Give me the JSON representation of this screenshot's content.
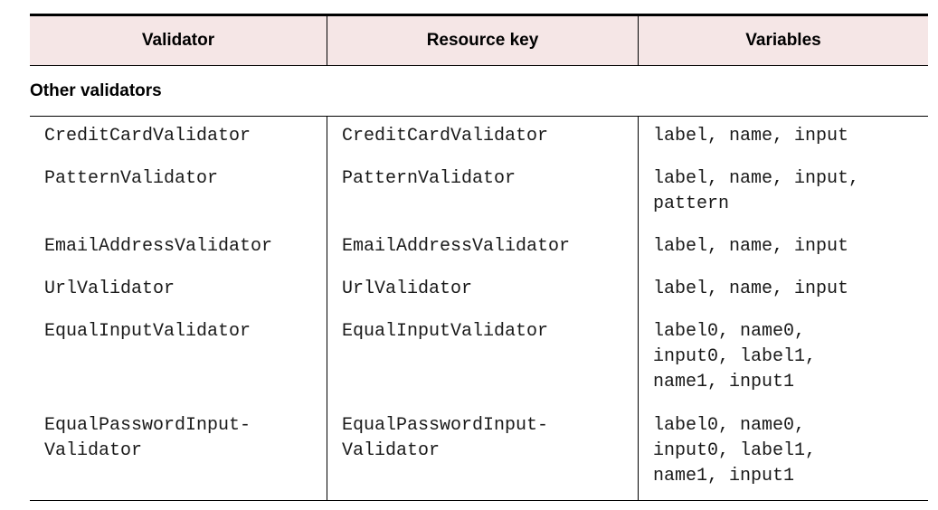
{
  "table": {
    "headers": [
      "Validator",
      "Resource key",
      "Variables"
    ],
    "section_title": "Other validators",
    "rows": [
      {
        "validator": "CreditCardValidator",
        "resource_key": "CreditCardValidator",
        "variables": "label, name, input"
      },
      {
        "validator": "PatternValidator",
        "resource_key": "PatternValidator",
        "variables": "label, name, input,\npattern"
      },
      {
        "validator": "EmailAddressValidator",
        "resource_key": "EmailAddressValidator",
        "variables": "label, name, input"
      },
      {
        "validator": "UrlValidator",
        "resource_key": "UrlValidator",
        "variables": "label, name, input"
      },
      {
        "validator": "EqualInputValidator",
        "resource_key": "EqualInputValidator",
        "variables": "label0, name0,\ninput0, label1,\nname1, input1"
      },
      {
        "validator": "EqualPasswordInput-\nValidator",
        "resource_key": "EqualPasswordInput-\nValidator",
        "variables": "label0, name0,\ninput0, label1,\nname1, input1"
      }
    ]
  },
  "colors": {
    "header_background": "#f5e6e6",
    "rule": "#000000"
  }
}
